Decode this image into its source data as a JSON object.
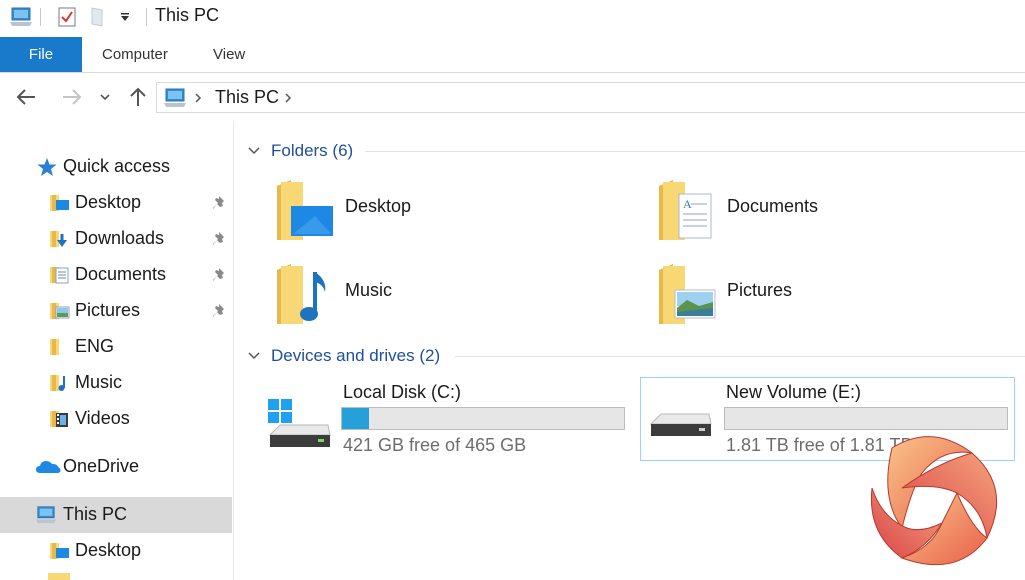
{
  "window": {
    "title": "This PC"
  },
  "quick_access_toolbar": {
    "icons": [
      "computer-icon",
      "properties-icon",
      "new-folder-icon",
      "customize-dropdown-icon"
    ]
  },
  "ribbon": {
    "tabs": [
      {
        "label": "File",
        "active": true
      },
      {
        "label": "Computer"
      },
      {
        "label": "View"
      }
    ]
  },
  "navigation": {
    "breadcrumb": [
      "This PC"
    ]
  },
  "sidebar": {
    "items": [
      {
        "label": "Quick access",
        "icon": "star-icon"
      },
      {
        "label": "Desktop",
        "icon": "desktop-folder-icon",
        "pinned": true
      },
      {
        "label": "Downloads",
        "icon": "downloads-folder-icon",
        "pinned": true
      },
      {
        "label": "Documents",
        "icon": "documents-folder-icon",
        "pinned": true
      },
      {
        "label": "Pictures",
        "icon": "pictures-folder-icon",
        "pinned": true
      },
      {
        "label": "ENG",
        "icon": "folder-icon"
      },
      {
        "label": "Music",
        "icon": "music-folder-icon"
      },
      {
        "label": "Videos",
        "icon": "videos-folder-icon"
      },
      {
        "label": "OneDrive",
        "icon": "onedrive-icon"
      },
      {
        "label": "This PC",
        "icon": "computer-icon",
        "selected": true
      },
      {
        "label": "Desktop",
        "icon": "desktop-folder-icon"
      }
    ]
  },
  "folders": {
    "header": "Folders (6)",
    "items": [
      {
        "label": "Desktop",
        "icon": "desktop-folder-icon"
      },
      {
        "label": "Documents",
        "icon": "documents-folder-icon"
      },
      {
        "label": "Music",
        "icon": "music-folder-icon"
      },
      {
        "label": "Pictures",
        "icon": "pictures-folder-icon"
      }
    ]
  },
  "drives": {
    "header": "Devices and drives (2)",
    "items": [
      {
        "name": "Local Disk (C:)",
        "free_text": "421 GB free of 465 GB",
        "used_fraction": 0.095,
        "icon": "windows-drive-icon"
      },
      {
        "name": "New Volume (E:)",
        "free_text": "1.81 TB free of 1.81 TB",
        "used_fraction": 0.0,
        "icon": "drive-icon",
        "selected": true
      }
    ]
  },
  "colors": {
    "accent": "#1979ca",
    "drive_fill": "#26a0da",
    "folder": "#f8d775",
    "header_text": "#1f4e9b"
  }
}
